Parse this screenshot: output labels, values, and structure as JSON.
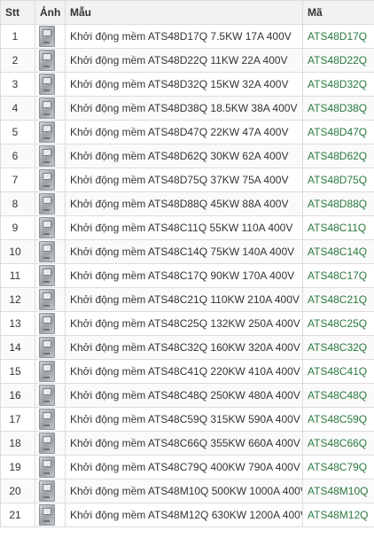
{
  "headers": {
    "stt": "Stt",
    "image": "Ảnh",
    "model": "Mẫu",
    "code": "Mã"
  },
  "colors": {
    "code_text": "#2b7a3d",
    "header_bg": "#f1f1f1",
    "border": "#dcdcdc"
  },
  "image_icon": "product-thumbnail-icon",
  "rows": [
    {
      "stt": "1",
      "model": "Khởi động mềm ATS48D17Q 7.5KW 17A 400V",
      "code": "ATS48D17Q"
    },
    {
      "stt": "2",
      "model": "Khởi động mềm ATS48D22Q 11KW 22A 400V",
      "code": "ATS48D22Q"
    },
    {
      "stt": "3",
      "model": "Khởi động mềm ATS48D32Q 15KW 32A 400V",
      "code": "ATS48D32Q"
    },
    {
      "stt": "4",
      "model": "Khởi động mềm ATS48D38Q 18.5KW 38A 400V",
      "code": "ATS48D38Q"
    },
    {
      "stt": "5",
      "model": "Khởi động mềm ATS48D47Q 22KW 47A 400V",
      "code": "ATS48D47Q"
    },
    {
      "stt": "6",
      "model": "Khởi động mềm ATS48D62Q 30KW 62A 400V",
      "code": "ATS48D62Q"
    },
    {
      "stt": "7",
      "model": "Khởi động mềm ATS48D75Q 37KW 75A 400V",
      "code": "ATS48D75Q"
    },
    {
      "stt": "8",
      "model": "Khởi động mềm ATS48D88Q 45KW 88A 400V",
      "code": "ATS48D88Q"
    },
    {
      "stt": "9",
      "model": "Khởi động mềm ATS48C11Q 55KW 110A 400V",
      "code": "ATS48C11Q"
    },
    {
      "stt": "10",
      "model": "Khởi động mềm ATS48C14Q 75KW 140A 400V",
      "code": "ATS48C14Q"
    },
    {
      "stt": "11",
      "model": "Khởi động mềm ATS48C17Q 90KW 170A 400V",
      "code": "ATS48C17Q"
    },
    {
      "stt": "12",
      "model": "Khởi động mềm ATS48C21Q 110KW 210A 400V",
      "code": "ATS48C21Q"
    },
    {
      "stt": "13",
      "model": "Khởi động mềm ATS48C25Q 132KW 250A 400V",
      "code": "ATS48C25Q"
    },
    {
      "stt": "14",
      "model": "Khởi động mềm ATS48C32Q 160KW 320A 400V",
      "code": "ATS48C32Q"
    },
    {
      "stt": "15",
      "model": "Khởi động mềm ATS48C41Q 220KW 410A 400V",
      "code": "ATS48C41Q"
    },
    {
      "stt": "16",
      "model": "Khởi động mềm ATS48C48Q 250KW 480A 400V",
      "code": "ATS48C48Q"
    },
    {
      "stt": "17",
      "model": "Khởi động mềm ATS48C59Q 315KW 590A 400V",
      "code": "ATS48C59Q"
    },
    {
      "stt": "18",
      "model": "Khởi động mềm ATS48C66Q 355KW 660A 400V",
      "code": "ATS48C66Q"
    },
    {
      "stt": "19",
      "model": "Khởi động mềm ATS48C79Q 400KW 790A 400V",
      "code": "ATS48C79Q"
    },
    {
      "stt": "20",
      "model": "Khởi động mềm ATS48M10Q 500KW 1000A 400V",
      "code": "ATS48M10Q"
    },
    {
      "stt": "21",
      "model": "Khởi động mềm ATS48M12Q 630KW 1200A 400V",
      "code": "ATS48M12Q"
    }
  ]
}
